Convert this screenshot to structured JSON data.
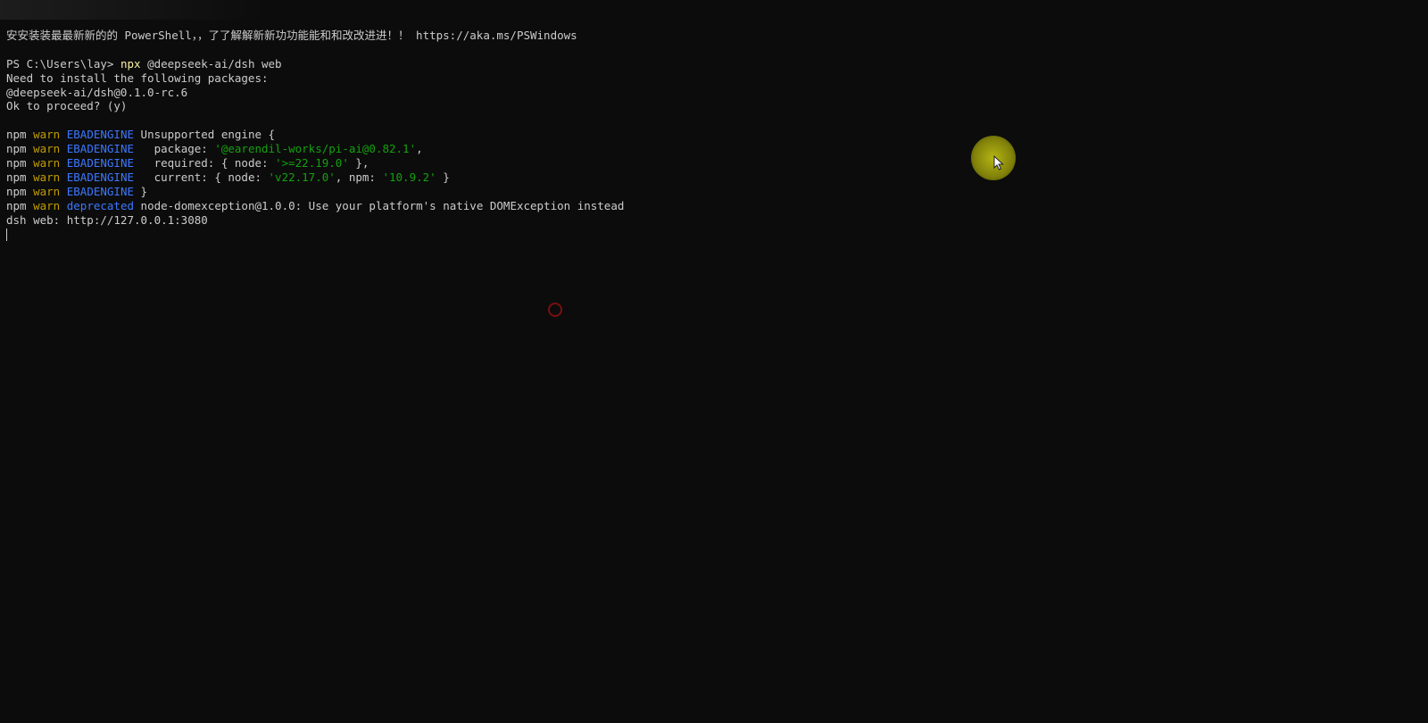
{
  "terminal": {
    "banner": "安安装装最最新新的的 PowerShell，，了了解解新新功功能能和和改改进进！！ https://aka.ms/PSWindows",
    "prompt": "PS C:\\Users\\lay>",
    "command_exe": "npx",
    "command_args": "@deepseek-ai/dsh web",
    "install_notice": "Need to install the following packages:",
    "install_package": "@deepseek-ai/dsh@0.1.0-rc.6",
    "proceed_prompt": "Ok to proceed? (y)",
    "warnings": [
      {
        "npm": "npm",
        "level": "warn",
        "tag": "EBADENGINE",
        "text": " Unsupported engine {"
      },
      {
        "npm": "npm",
        "level": "warn",
        "tag": "EBADENGINE",
        "text": "   package: ",
        "str": "'@earendil-works/pi-ai@0.82.1'",
        "tail": ","
      },
      {
        "npm": "npm",
        "level": "warn",
        "tag": "EBADENGINE",
        "text": "   required: { node: ",
        "str": "'>=22.19.0'",
        "tail": " },"
      },
      {
        "npm": "npm",
        "level": "warn",
        "tag": "EBADENGINE",
        "text": "   current: { node: ",
        "str": "'v22.17.0'",
        "mid": ", npm: ",
        "str2": "'10.9.2'",
        "tail": " }"
      },
      {
        "npm": "npm",
        "level": "warn",
        "tag": "EBADENGINE",
        "text": " }"
      },
      {
        "npm": "npm",
        "level": "warn",
        "tag": "deprecated",
        "text": " node-domexception@1.0.0: Use your platform's native DOMException instead"
      }
    ],
    "server_line": "dsh web: http://127.0.0.1:3080"
  },
  "colors": {
    "background": "#0c0c0c",
    "foreground": "#cccccc",
    "warn": "#c19c00",
    "tag": "#3b78ff",
    "string": "#13a10e",
    "command": "#f9f1a5"
  },
  "icons": {
    "pointer": "mouse-pointer-icon",
    "spinner": "loading-spinner-icon"
  }
}
